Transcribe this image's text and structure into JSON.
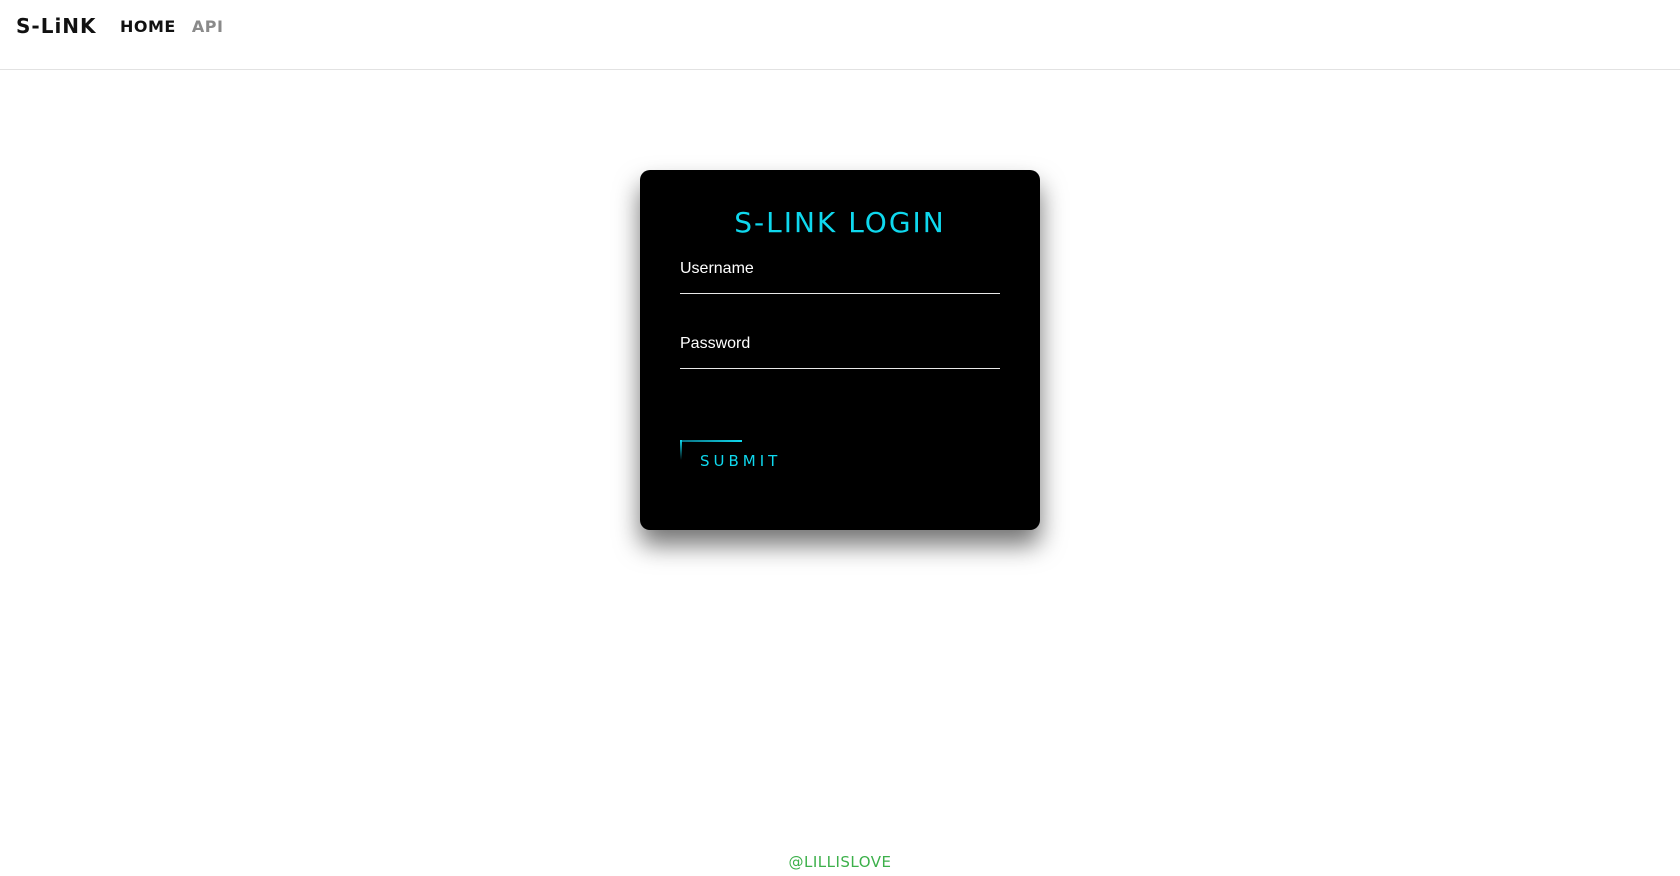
{
  "header": {
    "brand": "S-LiNK",
    "nav": [
      {
        "label": "HOME"
      },
      {
        "label": "API"
      }
    ]
  },
  "login": {
    "title": "S-LINK LOGIN",
    "username_label": "Username",
    "password_label": "Password",
    "submit_label": "SUBMIT"
  },
  "footer": {
    "credit": "@LILLISLOVE"
  },
  "colors": {
    "accent": "#0fd8ee",
    "card_bg": "#000000",
    "footer_text": "#3cb04a",
    "nav_active": "#111111",
    "nav_inactive": "#8a8a8a"
  }
}
